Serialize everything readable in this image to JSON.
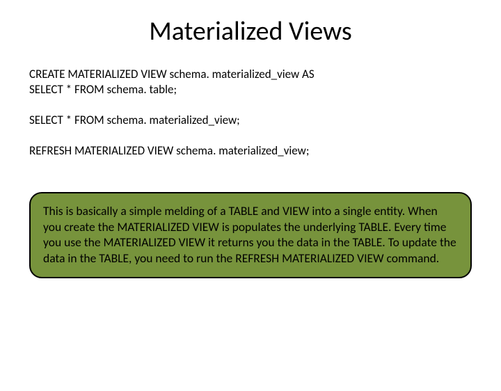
{
  "title": "Materialized Views",
  "code": {
    "block1_line1": "CREATE MATERIALIZED VIEW schema. materialized_view AS",
    "block1_line2": "SELECT * FROM schema. table;",
    "block2": "SELECT * FROM schema. materialized_view;",
    "block3": "REFRESH MATERIALIZED VIEW schema. materialized_view;"
  },
  "callout": "This is basically a simple melding of a TABLE and VIEW into a single entity. When you create the MATERIALIZED VIEW is populates the underlying TABLE. Every time you use the MATERIALIZED VIEW it returns you the data in the TABLE. To update the data in the TABLE, you need to run the REFRESH MATERIALIZED VIEW command."
}
